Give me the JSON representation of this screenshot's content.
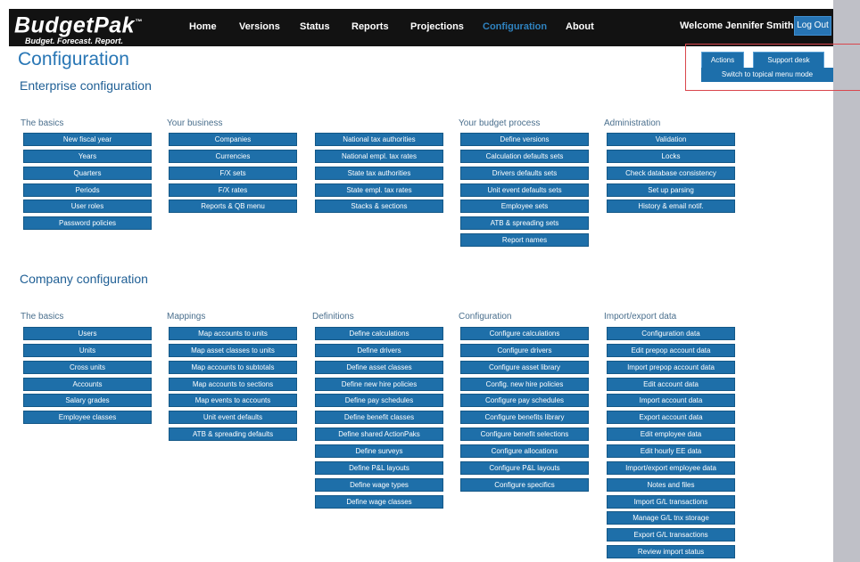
{
  "header": {
    "logo": {
      "name": "BudgetPak",
      "tm": "™",
      "tagline": "Budget. Forecast. Report."
    },
    "nav": [
      {
        "label": "Home",
        "active": false
      },
      {
        "label": "Versions",
        "active": false
      },
      {
        "label": "Status",
        "active": false
      },
      {
        "label": "Reports",
        "active": false
      },
      {
        "label": "Projections",
        "active": false
      },
      {
        "label": "Configuration",
        "active": true
      },
      {
        "label": "About",
        "active": false
      }
    ],
    "welcome": "Welcome Jennifer Smith!",
    "logout_label": "Log Out"
  },
  "page_title": "Configuration",
  "actions": {
    "actions_label": "Actions",
    "support_label": "Support desk",
    "switch_label": "Switch to topical menu mode"
  },
  "enterprise": {
    "title": "Enterprise configuration",
    "columns": [
      {
        "title": "The basics",
        "items": [
          "New fiscal year",
          "Years",
          "Quarters",
          "Periods",
          "User roles",
          "Password policies"
        ]
      },
      {
        "title": "Your business",
        "items": [
          "Companies",
          "Currencies",
          "F/X sets",
          "F/X rates",
          "Reports & QB menu"
        ]
      },
      {
        "title": "",
        "items": [
          "National tax authorities",
          "National empl. tax rates",
          "State tax authorities",
          "State empl. tax rates",
          "Stacks & sections"
        ]
      },
      {
        "title": "Your budget process",
        "items": [
          "Define versions",
          "Calculation defaults sets",
          "Drivers defaults sets",
          "Unit event defaults sets",
          "Employee sets",
          "ATB & spreading sets",
          "Report names"
        ]
      },
      {
        "title": "Administration",
        "items": [
          "Validation",
          "Locks",
          "Check database consistency",
          "Set up parsing",
          "History & email notif."
        ]
      }
    ]
  },
  "company": {
    "title": "Company configuration",
    "columns": [
      {
        "title": "The basics",
        "items": [
          "Users",
          "Units",
          "Cross units",
          "Accounts",
          "Salary grades",
          "Employee classes"
        ]
      },
      {
        "title": "Mappings",
        "items": [
          "Map accounts to units",
          "Map asset classes to units",
          "Map accounts  to subtotals",
          "Map accounts to sections",
          "Map events to accounts",
          "Unit event defaults",
          "ATB & spreading defaults"
        ]
      },
      {
        "title": "Definitions",
        "items": [
          "Define calculations",
          "Define drivers",
          "Define asset classes",
          "Define new hire policies",
          "Define pay schedules",
          "Define benefit classes",
          "Define shared ActionPaks",
          "Define surveys",
          "Define P&L layouts",
          "Define wage types",
          "Define wage classes"
        ]
      },
      {
        "title": "Configuration",
        "items": [
          "Configure calculations",
          "Configure drivers",
          "Configure asset library",
          "Config. new hire policies",
          "Configure pay schedules",
          "Configure benefits library",
          "Configure benefit selections",
          "Configure allocations",
          "Configure P&L layouts",
          "Configure specifics"
        ]
      },
      {
        "title": "Import/export data",
        "items": [
          "Configuration data",
          "Edit prepop account data",
          "Import prepop account data",
          "Edit account data",
          "Import account data",
          "Export account data",
          "Edit employee data",
          "Edit hourly EE data",
          "Import/export employee data",
          "Notes and files",
          "Import G/L transactions",
          "Manage G/L tnx storage",
          "Export G/L transactions",
          "Review import status"
        ]
      }
    ]
  }
}
